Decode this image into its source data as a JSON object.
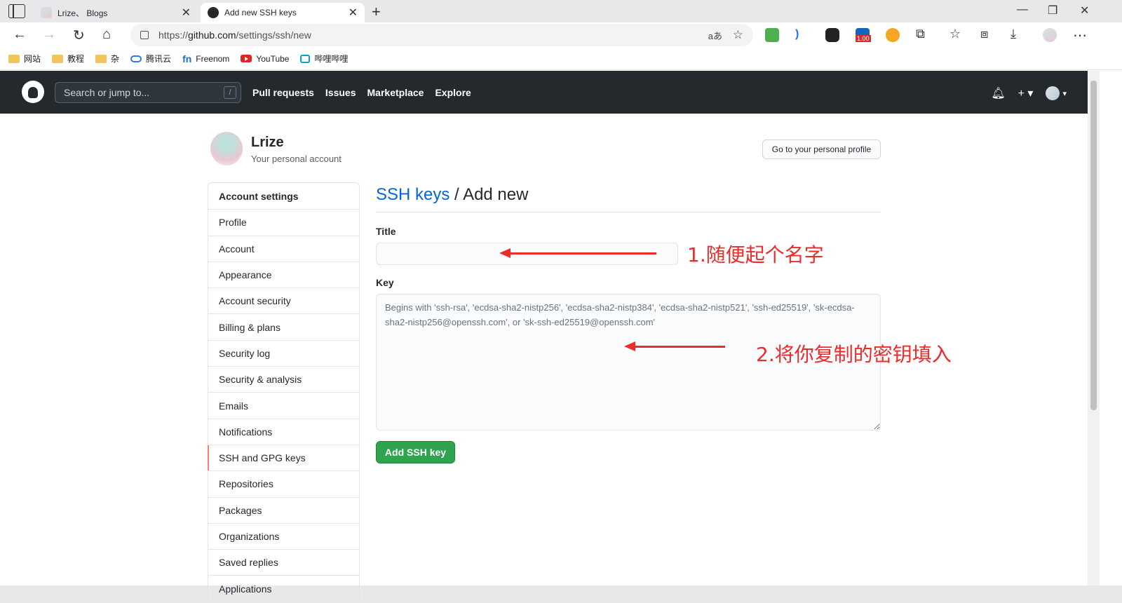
{
  "browser": {
    "tabs": [
      {
        "title": "Lrize、 Blogs",
        "active": false
      },
      {
        "title": "Add new SSH keys",
        "active": true
      }
    ],
    "url_prefix": "https://",
    "url_host": "github.com",
    "url_path": "/settings/ssh/new",
    "read_aloud_label": "aあ",
    "extension_badge": "1.00",
    "bookmarks": [
      {
        "label": "网站",
        "icon": "folder-icon"
      },
      {
        "label": "教程",
        "icon": "folder-icon"
      },
      {
        "label": "杂",
        "icon": "folder-icon"
      },
      {
        "label": "腾讯云",
        "icon": "cloud-icon"
      },
      {
        "label": "Freenom",
        "icon": "fn-icon"
      },
      {
        "label": "YouTube",
        "icon": "youtube-icon"
      },
      {
        "label": "哔哩哔哩",
        "icon": "bilibili-icon"
      }
    ]
  },
  "github": {
    "search_placeholder": "Search or jump to...",
    "search_shortcut": "/",
    "nav": [
      "Pull requests",
      "Issues",
      "Marketplace",
      "Explore"
    ]
  },
  "user": {
    "name": "Lrize",
    "subtitle": "Your personal account",
    "profile_button": "Go to your personal profile"
  },
  "sidebar": {
    "items": [
      "Account settings",
      "Profile",
      "Account",
      "Appearance",
      "Account security",
      "Billing & plans",
      "Security log",
      "Security & analysis",
      "Emails",
      "Notifications",
      "SSH and GPG keys",
      "Repositories",
      "Packages",
      "Organizations",
      "Saved replies",
      "Applications"
    ],
    "selected": "SSH and GPG keys"
  },
  "form": {
    "breadcrumb_link": "SSH keys",
    "breadcrumb_sep": " / ",
    "breadcrumb_current": "Add new",
    "title_label": "Title",
    "title_value": "",
    "key_label": "Key",
    "key_placeholder": "Begins with 'ssh-rsa', 'ecdsa-sha2-nistp256', 'ecdsa-sha2-nistp384', 'ecdsa-sha2-nistp521', 'ssh-ed25519', 'sk-ecdsa-sha2-nistp256@openssh.com', or 'sk-ssh-ed25519@openssh.com'",
    "submit_label": "Add SSH key"
  },
  "annotations": {
    "step1": "1.随便起个名字",
    "step2": "2.将你复制的密钥填入",
    "color": "#ee2b2b"
  },
  "colors": {
    "header_bg": "#24292e",
    "link": "#0366d6",
    "primary_button": "#2ea44f",
    "selected_indicator": "#f9826c"
  }
}
